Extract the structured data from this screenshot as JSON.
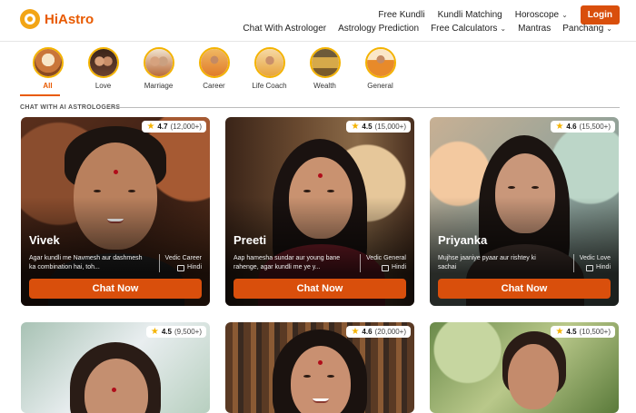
{
  "brand": {
    "name_hi": "Hi",
    "name_astro": "Astro"
  },
  "nav_top": {
    "free_kundli": "Free Kundli",
    "kundli_matching": "Kundli Matching",
    "horoscope": "Horoscope",
    "login": "Login"
  },
  "nav_bottom": {
    "chat": "Chat With Astrologer",
    "prediction": "Astrology Prediction",
    "calculators": "Free Calculators",
    "mantras": "Mantras",
    "panchang": "Panchang"
  },
  "categories": [
    {
      "label": "All",
      "active": true
    },
    {
      "label": "Love"
    },
    {
      "label": "Marriage"
    },
    {
      "label": "Career"
    },
    {
      "label": "Life Coach"
    },
    {
      "label": "Wealth"
    },
    {
      "label": "General"
    }
  ],
  "section_title": "CHAT WITH AI ASTROLOGERS",
  "cards": [
    {
      "name": "Vivek",
      "rating": "4.7",
      "count": "(12,000+)",
      "desc": "Agar kundli me Navmesh aur dashmesh ka combination hai, toh...",
      "type": "Vedic Career",
      "lang": "Hindi",
      "cta": "Chat Now"
    },
    {
      "name": "Preeti",
      "rating": "4.5",
      "count": "(15,000+)",
      "desc": "Aap hamesha sundar aur young bane rahenge, agar kundli me ye y...",
      "type": "Vedic General",
      "lang": "Hindi",
      "cta": "Chat Now"
    },
    {
      "name": "Priyanka",
      "rating": "4.6",
      "count": "(15,500+)",
      "desc": "Mujhse jaaniye pyaar aur rishtey ki sachai",
      "type": "Vedic Love",
      "lang": "Hindi",
      "cta": "Chat Now"
    },
    {
      "rating": "4.5",
      "count": "(9,500+)"
    },
    {
      "rating": "4.6",
      "count": "(20,000+)"
    },
    {
      "rating": "4.5",
      "count": "(10,500+)"
    }
  ]
}
